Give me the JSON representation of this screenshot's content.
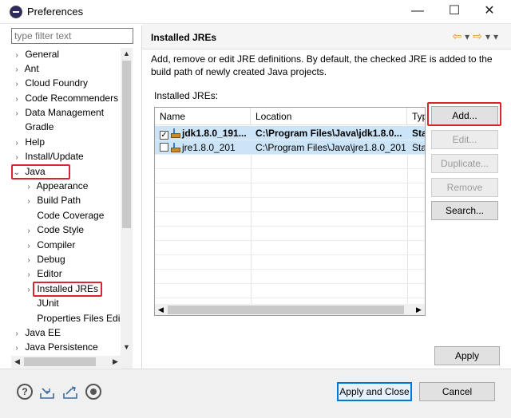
{
  "window": {
    "title": "Preferences",
    "minimize": "—",
    "maximize": "☐",
    "close": "✕"
  },
  "filter": {
    "placeholder": "type filter text"
  },
  "tree": {
    "items": [
      {
        "label": "General",
        "chevron": "›"
      },
      {
        "label": "Ant",
        "chevron": "›"
      },
      {
        "label": "Cloud Foundry",
        "chevron": "›"
      },
      {
        "label": "Code Recommenders",
        "chevron": "›"
      },
      {
        "label": "Data Management",
        "chevron": "›"
      },
      {
        "label": "Gradle",
        "chevron": ""
      },
      {
        "label": "Help",
        "chevron": "›"
      },
      {
        "label": "Install/Update",
        "chevron": "›"
      },
      {
        "label": "Java",
        "chevron": "⌄"
      },
      {
        "label": "Appearance",
        "chevron": "›"
      },
      {
        "label": "Build Path",
        "chevron": "›"
      },
      {
        "label": "Code Coverage",
        "chevron": ""
      },
      {
        "label": "Code Style",
        "chevron": "›"
      },
      {
        "label": "Compiler",
        "chevron": "›"
      },
      {
        "label": "Debug",
        "chevron": "›"
      },
      {
        "label": "Editor",
        "chevron": "›"
      },
      {
        "label": "Installed JREs",
        "chevron": "›"
      },
      {
        "label": "JUnit",
        "chevron": ""
      },
      {
        "label": "Properties Files Edi",
        "chevron": ""
      },
      {
        "label": "Java EE",
        "chevron": "›"
      },
      {
        "label": "Java Persistence",
        "chevron": "›"
      }
    ]
  },
  "page": {
    "title": "Installed JREs",
    "description": "Add, remove or edit JRE definitions. By default, the checked JRE is added to the build path of newly created Java projects.",
    "list_label": "Installed JREs:"
  },
  "table": {
    "columns": [
      "Name",
      "Location",
      "Typ"
    ],
    "rows": [
      {
        "checked": true,
        "name": "jdk1.8.0_191...",
        "location": "C:\\Program Files\\Java\\jdk1.8.0...",
        "type": "Sta"
      },
      {
        "checked": false,
        "name": "jre1.8.0_201",
        "location": "C:\\Program Files\\Java\\jre1.8.0_201",
        "type": "Sta"
      }
    ]
  },
  "buttons": {
    "add": "Add...",
    "edit": "Edit...",
    "duplicate": "Duplicate...",
    "remove": "Remove",
    "search": "Search...",
    "apply": "Apply",
    "apply_close": "Apply and Close",
    "cancel": "Cancel"
  },
  "icons": {
    "help": "?",
    "import": "import-icon",
    "export": "export-icon",
    "record": "record-icon"
  },
  "colors": {
    "highlight": "#d9262e",
    "selection": "#cce4f7",
    "default_button": "#0078d7"
  }
}
